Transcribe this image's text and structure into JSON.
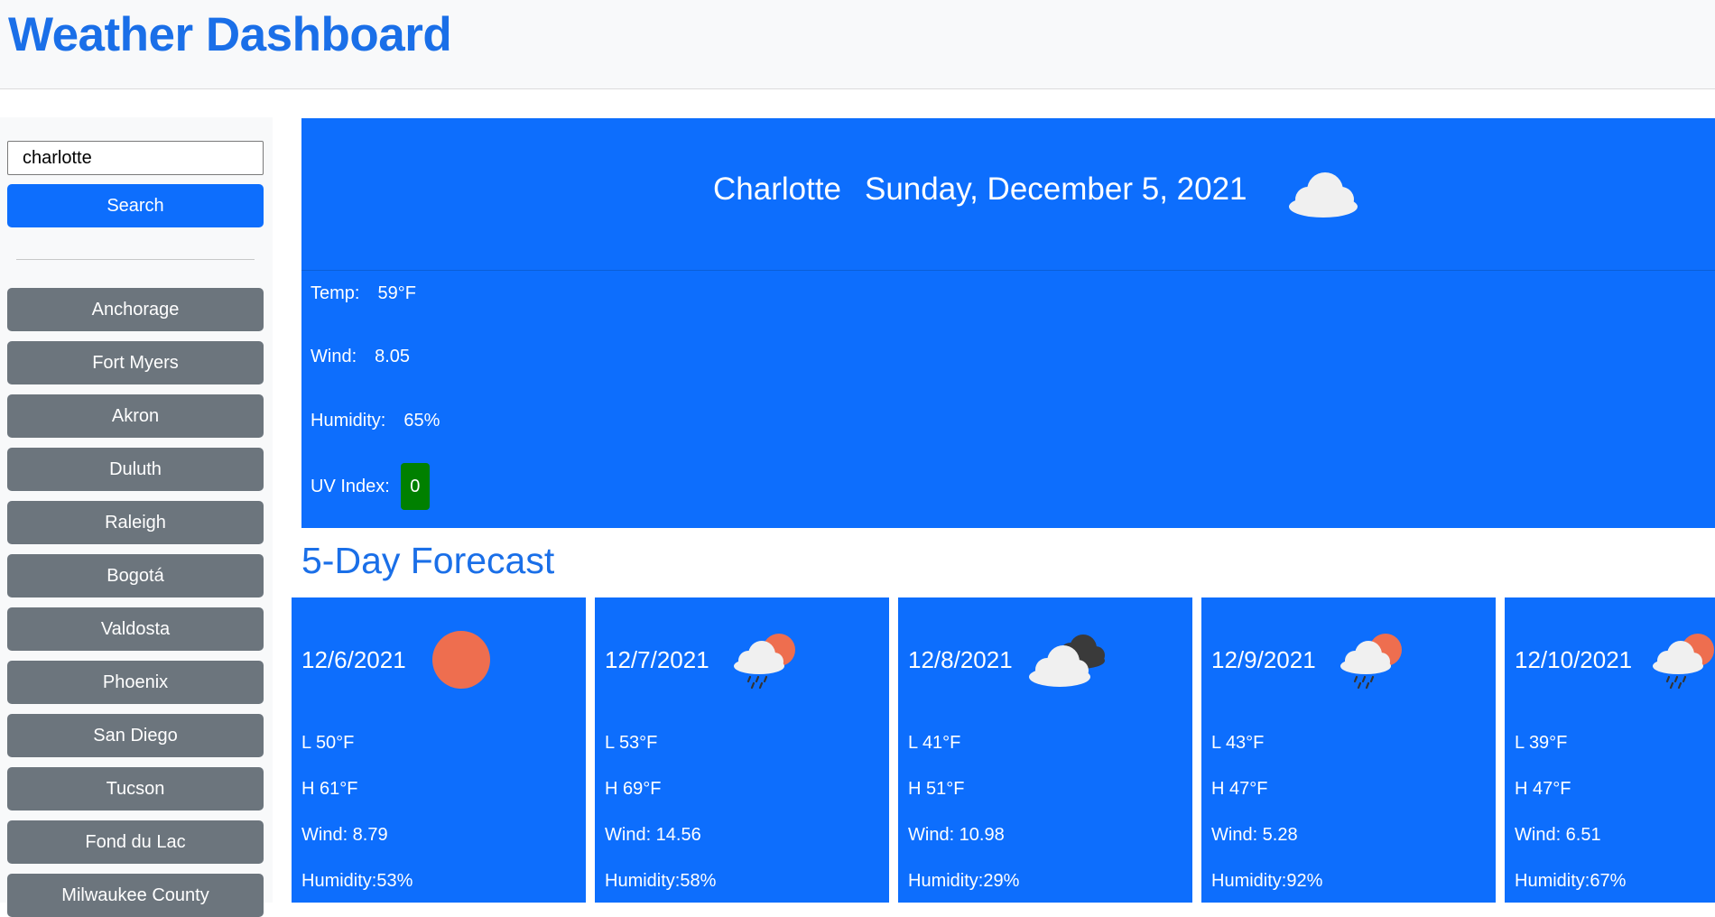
{
  "header": {
    "title": "Weather Dashboard"
  },
  "search": {
    "value": "charlotte",
    "button_label": "Search"
  },
  "history": [
    "Anchorage",
    "Fort Myers",
    "Akron",
    "Duluth",
    "Raleigh",
    "Bogotá",
    "Valdosta",
    "Phoenix",
    "San Diego",
    "Tucson",
    "Fond du Lac",
    "Milwaukee County"
  ],
  "current": {
    "city": "Charlotte",
    "date": "Sunday, December 5, 2021",
    "icon": "cloud-icon",
    "temp_label": "Temp:",
    "temp": "59°F",
    "wind_label": "Wind:",
    "wind": "8.05",
    "humidity_label": "Humidity:",
    "humidity": "65%",
    "uv_label": "UV Index:",
    "uv": "0",
    "uv_color": "#008000"
  },
  "forecast_title": "5-Day Forecast",
  "forecast": [
    {
      "date": "12/6/2021",
      "icon": "sun-icon",
      "low": "L 50°F",
      "high": "H 61°F",
      "wind": "Wind: 8.79",
      "humidity": "Humidity:53%"
    },
    {
      "date": "12/7/2021",
      "icon": "rain-sun-icon",
      "low": "L 53°F",
      "high": "H 69°F",
      "wind": "Wind: 14.56",
      "humidity": "Humidity:58%"
    },
    {
      "date": "12/8/2021",
      "icon": "overcast-icon",
      "low": "L 41°F",
      "high": "H 51°F",
      "wind": "Wind: 10.98",
      "humidity": "Humidity:29%"
    },
    {
      "date": "12/9/2021",
      "icon": "rain-sun-icon",
      "low": "L 43°F",
      "high": "H 47°F",
      "wind": "Wind: 5.28",
      "humidity": "Humidity:92%"
    },
    {
      "date": "12/10/2021",
      "icon": "rain-sun-icon",
      "low": "L 39°F",
      "high": "H 47°F",
      "wind": "Wind: 6.51",
      "humidity": "Humidity:67%"
    }
  ],
  "colors": {
    "title": "#1a6fe8",
    "primary": "#0d6efd",
    "secondary": "#6c757d",
    "sun": "#ee6e4f"
  }
}
